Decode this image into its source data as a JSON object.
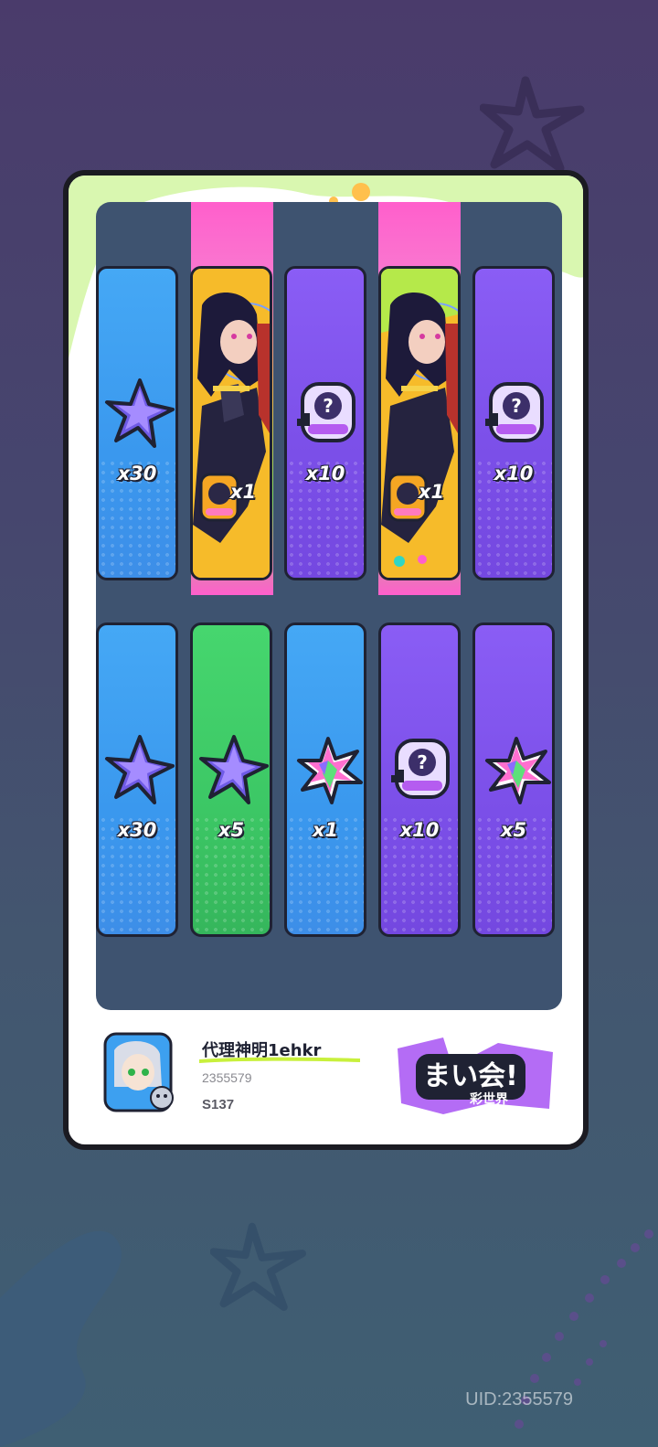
{
  "colors": {
    "blue_tile": "#3a98ee",
    "purple_tile": "#7b4fe8",
    "green_tile": "#3cc765",
    "gold_tile": "#f5b324",
    "board_bg": "#3e5370",
    "outline": "#1f2233"
  },
  "rewards": {
    "row1": [
      {
        "type": "star-crystal",
        "color": "blue",
        "qty": "x30",
        "icon": "purple-star-crystal-icon"
      },
      {
        "type": "character",
        "color": "gold",
        "qty": "x1",
        "icon": "character-portrait-badge-icon",
        "featured": true
      },
      {
        "type": "mystery-item",
        "color": "purple",
        "qty": "x10",
        "icon": "mystery-capsule-icon"
      },
      {
        "type": "character",
        "color": "gold",
        "qty": "x1",
        "icon": "character-portrait-badge-icon",
        "featured": true
      },
      {
        "type": "mystery-item",
        "color": "purple",
        "qty": "x10",
        "icon": "mystery-capsule-icon"
      }
    ],
    "row2": [
      {
        "type": "star-crystal",
        "color": "blue",
        "qty": "x30",
        "icon": "purple-star-crystal-icon"
      },
      {
        "type": "star-crystal",
        "color": "green",
        "qty": "x5",
        "icon": "purple-star-crystal-icon"
      },
      {
        "type": "rainbow-leaf",
        "color": "blue",
        "qty": "x1",
        "icon": "rainbow-leaf-icon"
      },
      {
        "type": "mystery-item",
        "color": "purple",
        "qty": "x10",
        "icon": "mystery-capsule-icon"
      },
      {
        "type": "rainbow-leaf",
        "color": "purple",
        "qty": "x5",
        "icon": "rainbow-leaf-icon"
      }
    ]
  },
  "player": {
    "name": "代理神明1ehkr",
    "id": "2355579",
    "level": "S137"
  },
  "footer": {
    "uid": "UID:2355579"
  }
}
